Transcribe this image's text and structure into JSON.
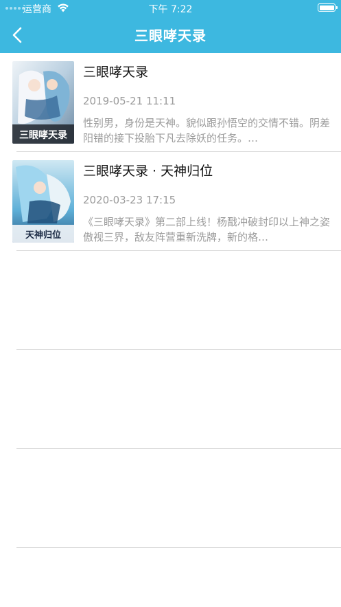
{
  "status": {
    "carrier": "运营商",
    "time": "下午 7:22"
  },
  "nav": {
    "title": "三眼哮天录"
  },
  "items": [
    {
      "title": "三眼哮天录",
      "date": "2019-05-21 11:11",
      "desc": "性别男，身份是天神。貌似跟孙悟空的交情不错。阴差阳错的接下投胎下凡去除妖的任务。…",
      "cover_text": "三眼哮天录"
    },
    {
      "title": "三眼哮天录 · 天神归位",
      "date": "2020-03-23 17:15",
      "desc": "《三眼哮天录》第二部上线！杨戬冲破封印以上神之姿傲视三界，敌友阵营重新洗牌，新的格…",
      "cover_text": "天神归位"
    }
  ],
  "colors": {
    "header": "#3db8e0",
    "muted": "#9b9b9b",
    "separator": "#dcdcdc"
  }
}
